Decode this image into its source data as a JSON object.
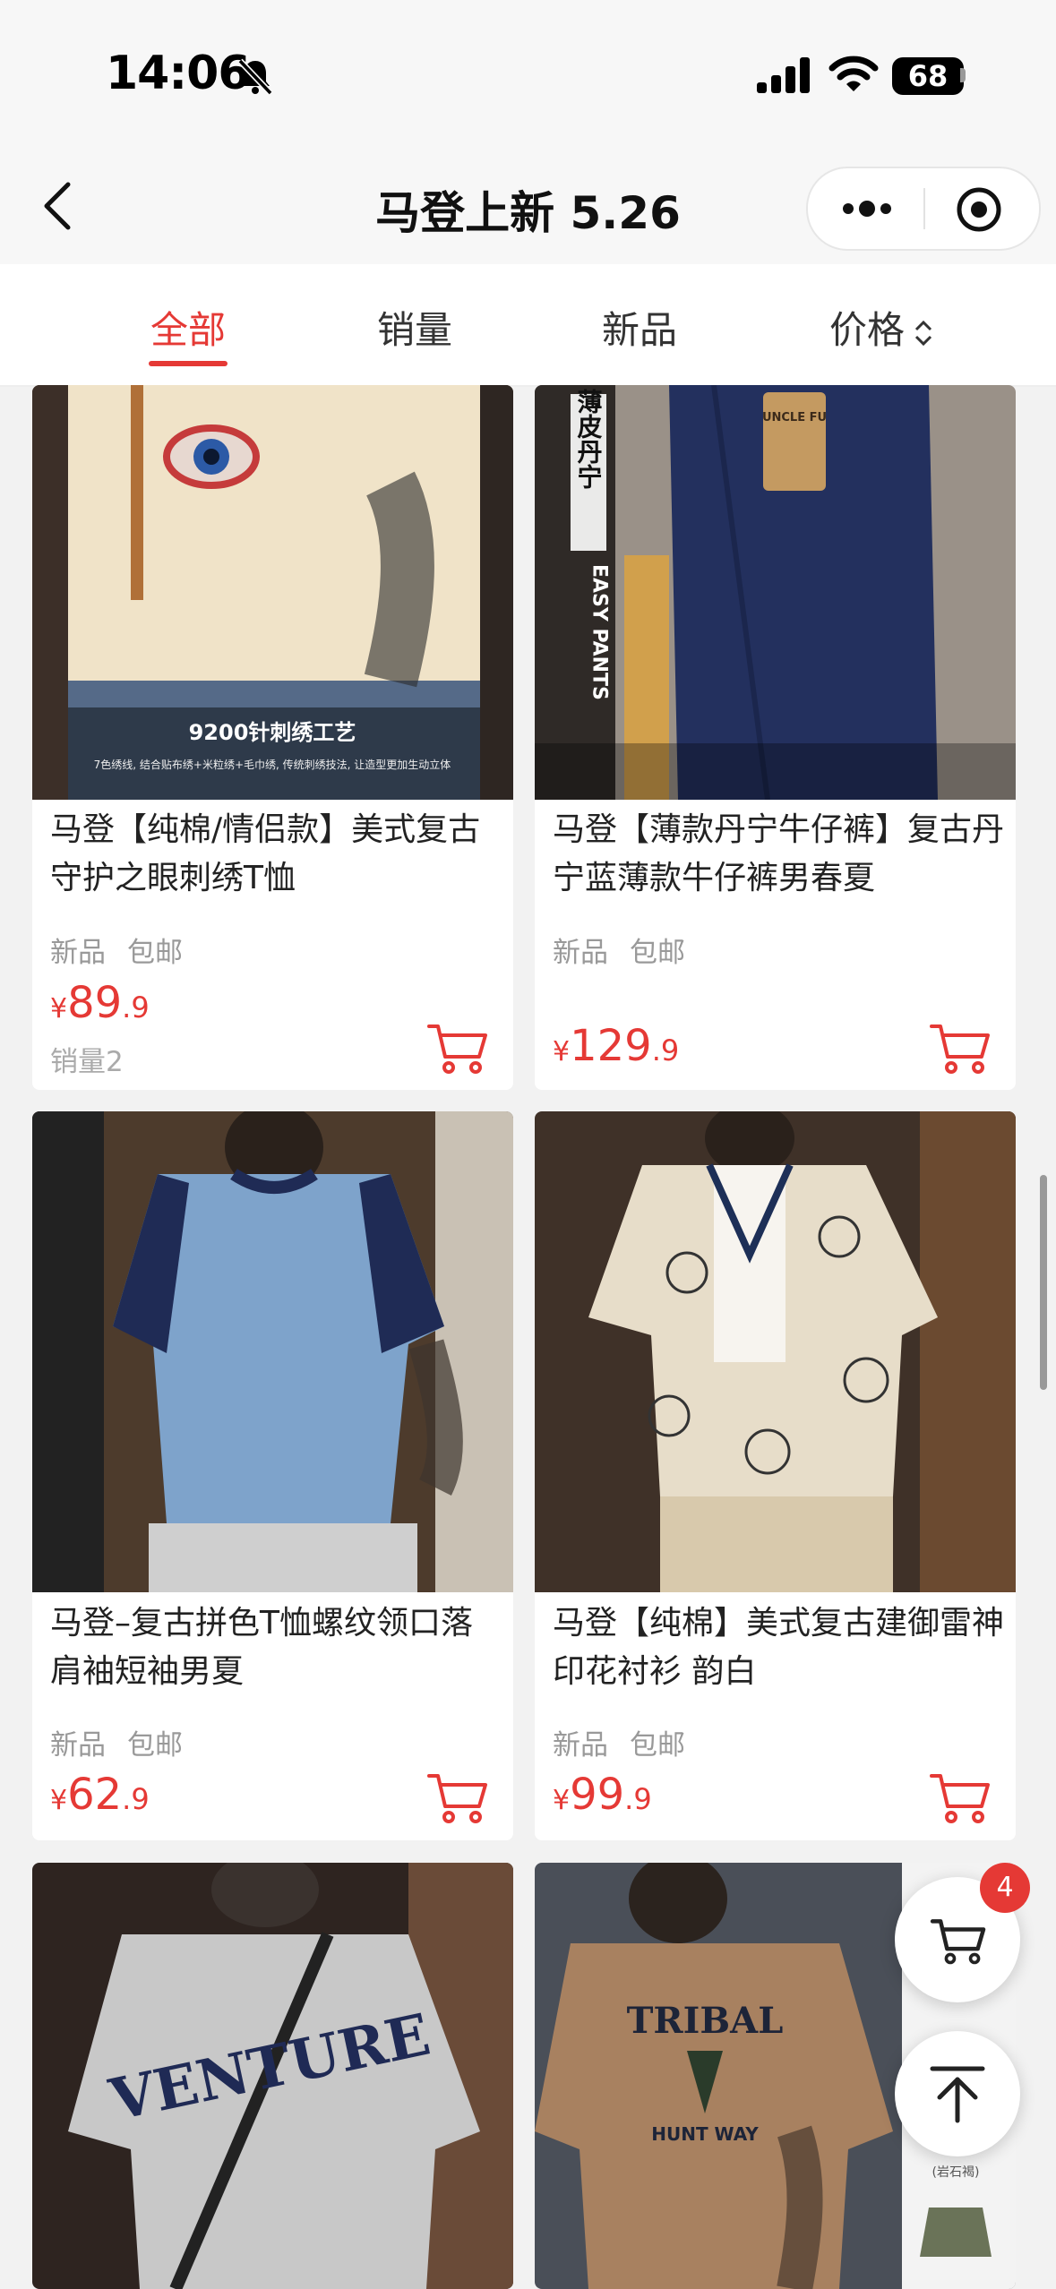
{
  "status_bar": {
    "time": "14:06",
    "battery": "68"
  },
  "nav": {
    "title": "马登上新 5.26"
  },
  "tabs": [
    {
      "label": "全部",
      "active": true
    },
    {
      "label": "销量",
      "active": false
    },
    {
      "label": "新品",
      "active": false
    },
    {
      "label": "价格",
      "active": false
    }
  ],
  "products": [
    {
      "name": "马登【纯棉/情侣款】美式复古守护之眼刺绣T恤",
      "tags": [
        "新品",
        "包邮"
      ],
      "price_currency": "¥",
      "price_int": "89",
      "price_dec": ".9",
      "sales": "销量2",
      "image_caption": "9200针刺绣工艺",
      "image_subcaption": "7色绣线, 结合贴布绣+米粒绣+毛巾绣, 传统刺绣技法, 让造型更加生动立体"
    },
    {
      "name": "马登【薄款丹宁牛仔裤】复古丹宁蓝薄款牛仔裤男春夏",
      "tags": [
        "新品",
        "包邮"
      ],
      "price_currency": "¥",
      "price_int": "129",
      "price_dec": ".9",
      "image_caption": "薄皮丹宁",
      "image_subcaption": "EASY PANTS",
      "image_tag": "UNCLE FU"
    },
    {
      "name": "马登–复古拼色T恤螺纹领口落肩袖短袖男夏",
      "tags": [
        "新品",
        "包邮"
      ],
      "price_currency": "¥",
      "price_int": "62",
      "price_dec": ".9"
    },
    {
      "name": "马登【纯棉】美式复古建御雷神印花衬衫 韵白",
      "tags": [
        "新品",
        "包邮"
      ],
      "price_currency": "¥",
      "price_int": "99",
      "price_dec": ".9"
    },
    {
      "image_caption": "VENTURE"
    },
    {
      "image_caption": "TRIBAL",
      "image_subcaption": "HUNT WAY",
      "image_side_label": "(岩石褐)"
    }
  ],
  "floating": {
    "cart_badge": "4"
  },
  "colors": {
    "accent": "#e53935",
    "tag": "#999999",
    "bg": "#f2f2f2"
  }
}
